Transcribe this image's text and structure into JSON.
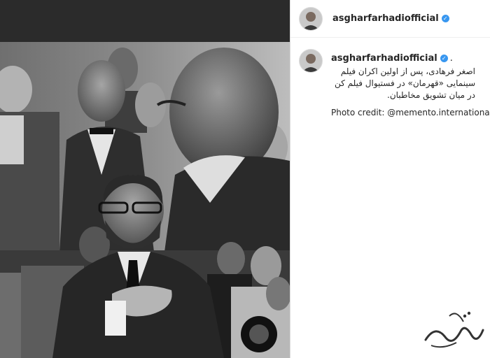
{
  "header": {
    "username": "asgharfarhadiofficial",
    "verified_icon": "verified-badge-icon"
  },
  "post": {
    "username": "asgharfarhadiofficial",
    "separator": ".",
    "caption_lines": [
      "اصغر فرهادی، پس از اولین اکران فیلم",
      "سینمایی «قهرمان» در فستیوال فیلم کن",
      "در میان تشویق مخاطبان."
    ],
    "credit": "Photo credit: @memento.international"
  },
  "colors": {
    "verified": "#3897f0",
    "text": "#262626",
    "border": "#dbdbdb"
  }
}
